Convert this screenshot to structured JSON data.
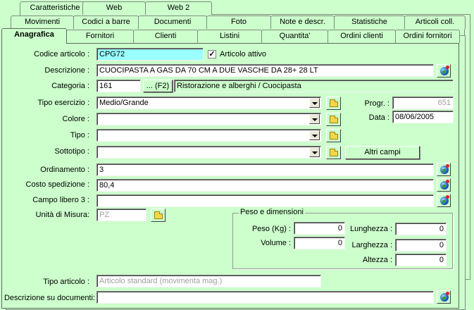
{
  "tabs": {
    "row1": [
      "Caratteristiche",
      "Web",
      "Web 2"
    ],
    "row2": [
      "Movimenti",
      "Codici a barre",
      "Documenti",
      "Foto",
      "Note e descr.",
      "Statistiche",
      "Articoli coll."
    ],
    "row3": [
      "Anagrafica",
      "Fornitori",
      "Clienti",
      "Listini",
      "Quantita'",
      "Ordini clienti",
      "Ordini fornitori"
    ]
  },
  "form": {
    "codice_label": "Codice articolo :",
    "codice_value": "CPG72",
    "attivo_label": "Articolo attivo",
    "attivo_checked": true,
    "descrizione_label": "Descrizione :",
    "descrizione_value": "CUOCIPASTA A GAS DA 70 CM A DUE VASCHE DA 28+ 28 LT",
    "categoria_label": "Categoria :",
    "categoria_code": "161",
    "categoria_button": "... (F2)",
    "categoria_desc": "Ristorazione e alberghi / Cuocipasta",
    "tipo_esercizio_label": "Tipo esercizio :",
    "tipo_esercizio_value": "Medio/Grande",
    "colore_label": "Colore :",
    "colore_value": "",
    "tipo_label": "Tipo :",
    "tipo_value": "",
    "sottotipo_label": "Sottotipo :",
    "sottotipo_value": "",
    "progr_label": "Progr. :",
    "progr_value": "651",
    "data_label": "Data :",
    "data_value": "08/06/2005",
    "altri_campi_button": "Altri campi",
    "ordinamento_label": "Ordinamento :",
    "ordinamento_value": "3",
    "costo_label": "Costo spedizione :",
    "costo_value": "80,4",
    "campo3_label": "Campo libero 3 :",
    "campo3_value": "",
    "um_label": "Unità di Misura:",
    "um_value": "PZ",
    "tipo_articolo_label": "Tipo articolo :",
    "tipo_articolo_value": "Articolo standard (movimenta mag.)",
    "descr_doc_label": "Descrizione su documenti:",
    "descr_doc_value": ""
  },
  "peso_dimensioni": {
    "title": "Peso e dimensioni",
    "peso_label": "Peso (Kg) :",
    "peso_value": "0",
    "volume_label": "Volume :",
    "volume_value": "0",
    "lunghezza_label": "Lunghezza :",
    "lunghezza_value": "0",
    "larghezza_label": "Larghezza :",
    "larghezza_value": "0",
    "altezza_label": "Altezza :",
    "altezza_value": "0"
  },
  "colors": {
    "background": "#ccffcc",
    "highlight_field": "#99ffff"
  }
}
